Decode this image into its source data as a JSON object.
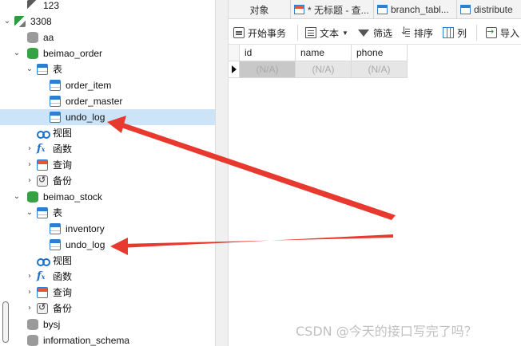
{
  "navigator": {
    "items": [
      {
        "label": "123",
        "icon": "connection-icon"
      },
      {
        "label": "3308",
        "icon": "connection-active-icon"
      },
      {
        "label": "aa",
        "icon": "database-icon"
      },
      {
        "label": "beimao_order",
        "icon": "database-open-icon"
      },
      {
        "label": "表",
        "icon": "tables-folder-icon"
      },
      {
        "label": "order_item",
        "icon": "table-icon"
      },
      {
        "label": "order_master",
        "icon": "table-icon"
      },
      {
        "label": "undo_log",
        "icon": "table-icon",
        "selected": true
      },
      {
        "label": "视图",
        "icon": "view-icon"
      },
      {
        "label": "函数",
        "icon": "function-icon"
      },
      {
        "label": "查询",
        "icon": "query-icon"
      },
      {
        "label": "备份",
        "icon": "backup-icon"
      },
      {
        "label": "beimao_stock",
        "icon": "database-open-icon"
      },
      {
        "label": "表",
        "icon": "tables-folder-icon"
      },
      {
        "label": "inventory",
        "icon": "table-icon"
      },
      {
        "label": "undo_log",
        "icon": "table-icon"
      },
      {
        "label": "视图",
        "icon": "view-icon"
      },
      {
        "label": "函数",
        "icon": "function-icon"
      },
      {
        "label": "查询",
        "icon": "query-icon"
      },
      {
        "label": "备份",
        "icon": "backup-icon"
      },
      {
        "label": "bysj",
        "icon": "database-icon"
      },
      {
        "label": "information_schema",
        "icon": "database-icon"
      }
    ]
  },
  "tabs": [
    {
      "label": "对象",
      "icon": ""
    },
    {
      "label": "* 无标题 - 查...",
      "icon": "query-tab-icon"
    },
    {
      "label": "branch_tabl...",
      "icon": "table-tab-icon"
    },
    {
      "label": "distribute",
      "icon": "table-tab-icon"
    }
  ],
  "toolbar": {
    "begin_transaction": "开始事务",
    "text": "文本",
    "filter": "筛选",
    "sort": "排序",
    "columns": "列",
    "import": "导入"
  },
  "grid": {
    "columns": [
      "id",
      "name",
      "phone"
    ],
    "rows": [
      [
        "(N/A)",
        "(N/A)",
        "(N/A)"
      ]
    ]
  },
  "colors": {
    "selection": "#cce4f7",
    "arrow": "#e8392f",
    "accent": "#2d7fd1"
  },
  "watermark": "CSDN @今天的接口写完了吗？"
}
